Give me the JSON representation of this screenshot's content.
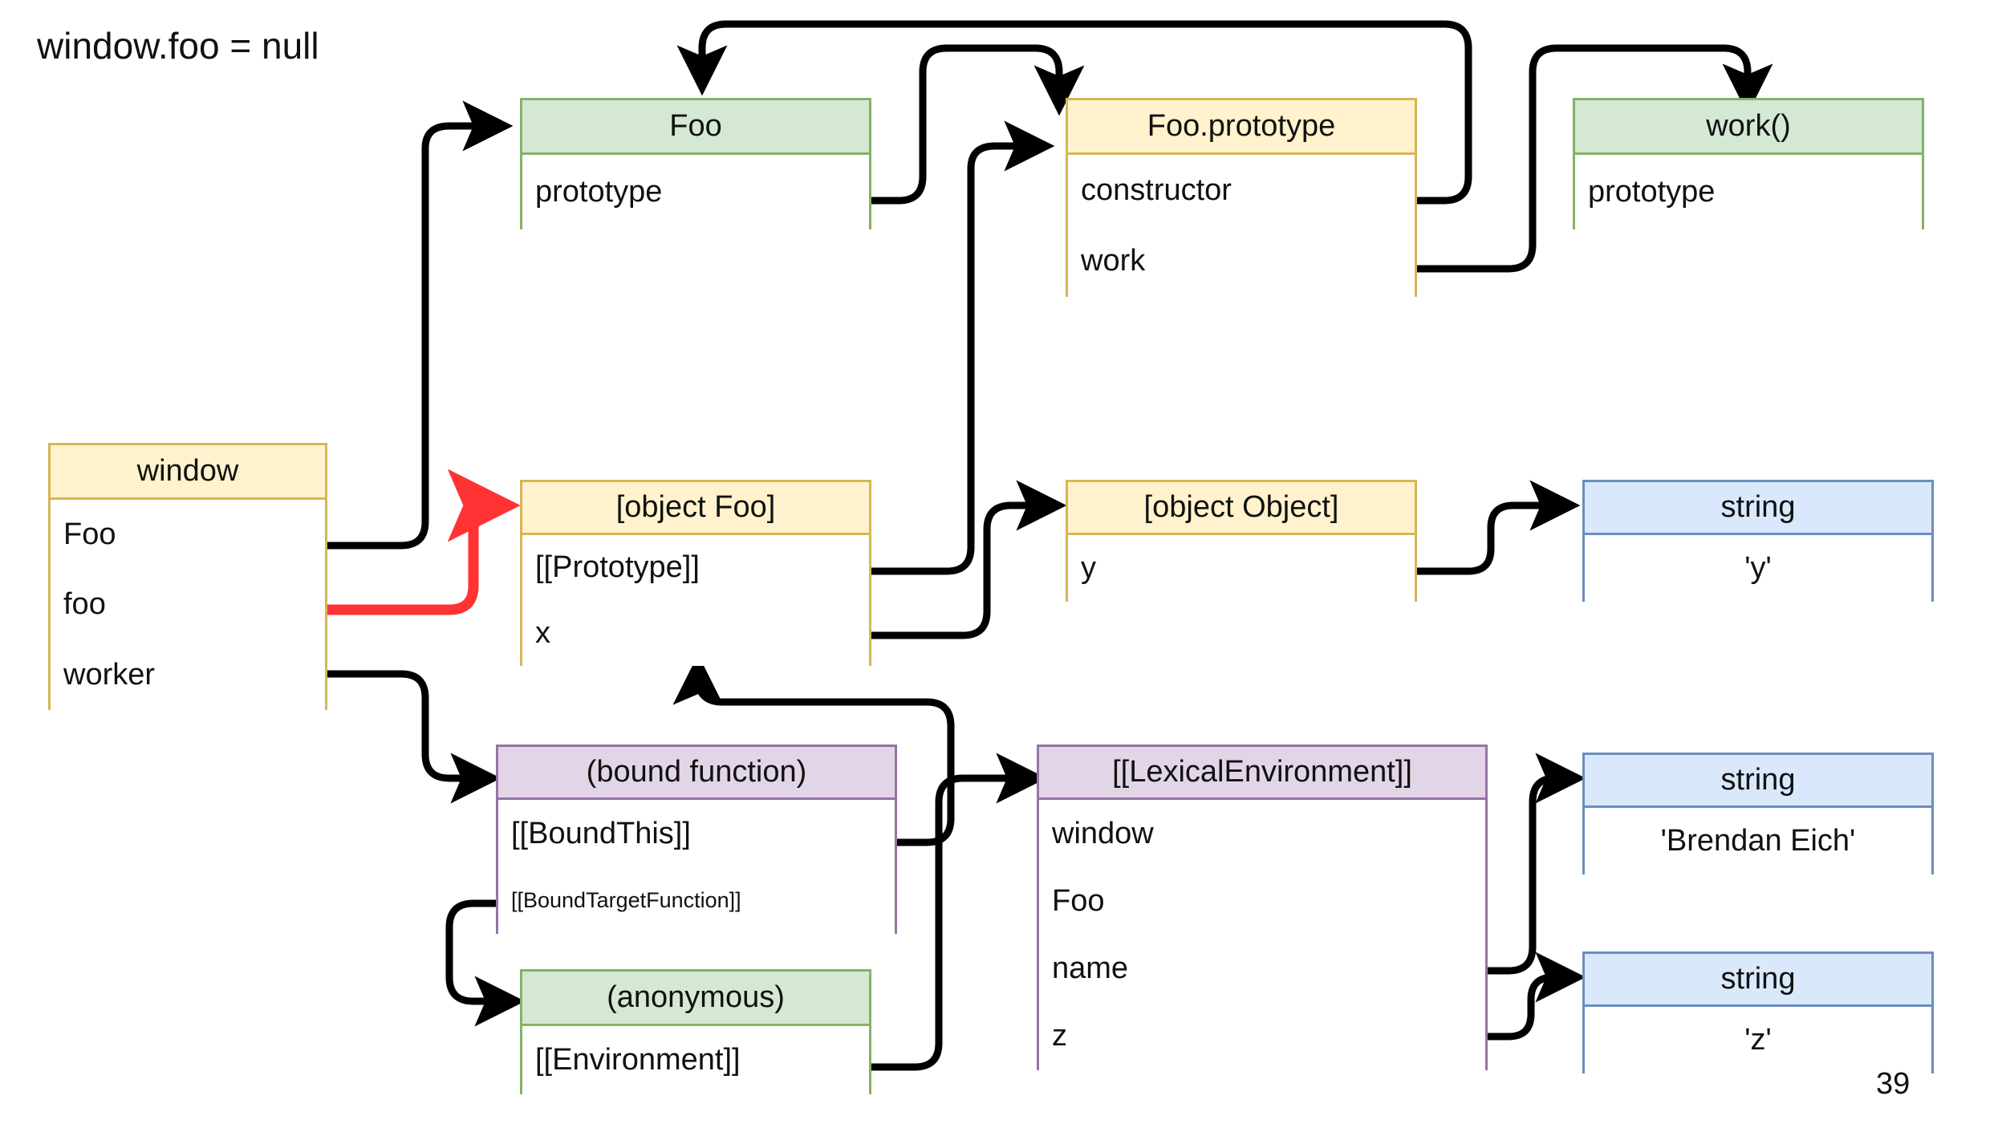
{
  "title": "window.foo = null",
  "page_number": "39",
  "colors": {
    "green_fill": "#d5e8d4",
    "green_stroke": "#82b366",
    "orange_fill": "#fff2cc",
    "orange_stroke": "#d6b656",
    "purple_fill": "#e1d5e7",
    "purple_stroke": "#9673a6",
    "blue_fill": "#dae8fc",
    "blue_stroke": "#6c8ebf",
    "edge": "#000000",
    "highlight_edge": "#ff3333"
  },
  "nodes": {
    "foo_ctor": {
      "header": "Foo",
      "rows": [
        "prototype"
      ]
    },
    "foo_proto": {
      "header": "Foo.prototype",
      "rows": [
        "constructor",
        "work"
      ]
    },
    "work_fn": {
      "header": "work()",
      "rows": [
        "prototype"
      ]
    },
    "window": {
      "header": "window",
      "rows": [
        "Foo",
        "foo",
        "worker"
      ]
    },
    "object_foo": {
      "header": "[object Foo]",
      "rows": [
        "[[Prototype]]",
        "x"
      ]
    },
    "object_obj": {
      "header": "[object Object]",
      "rows": [
        "y"
      ]
    },
    "string_y": {
      "header": "string",
      "rows": [
        "'y'"
      ]
    },
    "bound_fn": {
      "header": "(bound function)",
      "rows": [
        "[[BoundThis]]",
        "[[BoundTargetFunction]]"
      ]
    },
    "lex_env": {
      "header": "[[LexicalEnvironment]]",
      "rows": [
        "window",
        "Foo",
        "name",
        "z"
      ]
    },
    "string_be": {
      "header": "string",
      "rows": [
        "'Brendan Eich'"
      ]
    },
    "anonymous": {
      "header": "(anonymous)",
      "rows": [
        "[[Environment]]"
      ]
    },
    "string_z": {
      "header": "string",
      "rows": [
        "'z'"
      ]
    }
  },
  "edges": [
    {
      "name": "window-Foo-to-Foo",
      "from": "window.Foo",
      "to": "foo_ctor.header",
      "color": "#000000"
    },
    {
      "name": "window-foo-to-object-Foo",
      "from": "window.foo",
      "to": "object_foo.header",
      "color": "#ff3333"
    },
    {
      "name": "window-worker-to-bound-function",
      "from": "window.worker",
      "to": "bound_fn.header",
      "color": "#000000"
    },
    {
      "name": "Foo-prototype-to-Foo.prototype",
      "from": "foo_ctor.prototype",
      "to": "foo_proto.header",
      "color": "#000000"
    },
    {
      "name": "Foo.prototype-constructor-to-Foo",
      "from": "foo_proto.constructor",
      "to": "foo_ctor.header",
      "color": "#000000"
    },
    {
      "name": "Foo.prototype-work-to-work",
      "from": "foo_proto.work",
      "to": "work_fn.header",
      "color": "#000000"
    },
    {
      "name": "object-Foo-prototype-to-Foo.prototype",
      "from": "object_foo.[[Prototype]]",
      "to": "foo_proto.header",
      "color": "#000000"
    },
    {
      "name": "object-Foo-x-to-object-Object",
      "from": "object_foo.x",
      "to": "object_obj.header",
      "color": "#000000"
    },
    {
      "name": "object-Object-y-to-string-y",
      "from": "object_obj.y",
      "to": "string_y.header",
      "color": "#000000"
    },
    {
      "name": "bound-this-to-object-Foo",
      "from": "bound_fn.[[BoundThis]]",
      "to": "object_foo.bottom",
      "color": "#000000"
    },
    {
      "name": "bound-target-function-to-anonymous",
      "from": "bound_fn.[[BoundTargetFunction]]",
      "to": "anonymous.header",
      "color": "#000000"
    },
    {
      "name": "anonymous-environment-to-lexical-env",
      "from": "anonymous.[[Environment]]",
      "to": "lex_env.header",
      "color": "#000000"
    },
    {
      "name": "lex-env-name-to-string-brendan-eich",
      "from": "lex_env.name",
      "to": "string_be.header",
      "color": "#000000"
    },
    {
      "name": "lex-env-z-to-string-z",
      "from": "lex_env.z",
      "to": "string_z.header",
      "color": "#000000"
    }
  ]
}
